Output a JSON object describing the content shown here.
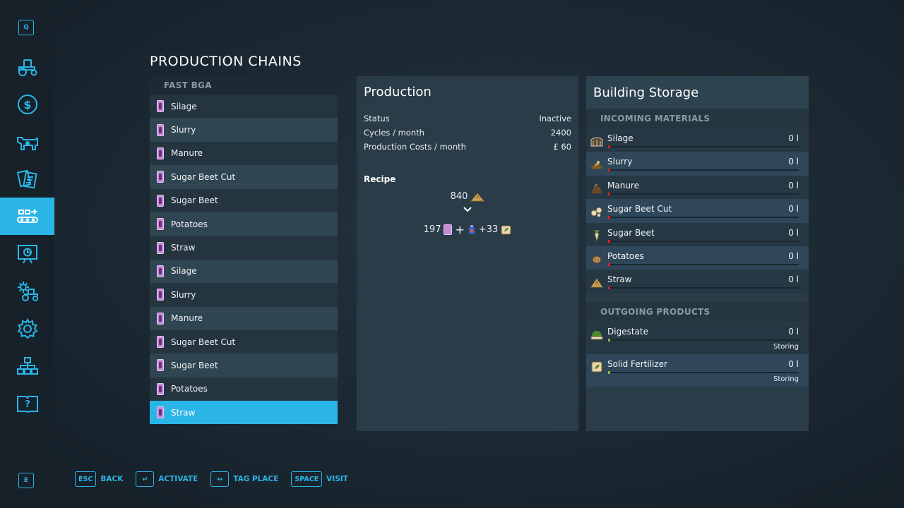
{
  "sidebar": {
    "top_key": "Q",
    "bottom_key": "E",
    "items": [
      {
        "icon": "tractor-icon",
        "active": false
      },
      {
        "icon": "money-icon",
        "active": false
      },
      {
        "icon": "cow-icon",
        "active": false
      },
      {
        "icon": "contracts-icon",
        "active": false
      },
      {
        "icon": "production-chain-icon",
        "active": true
      },
      {
        "icon": "statistics-icon",
        "active": false
      },
      {
        "icon": "garage-icon",
        "active": false
      },
      {
        "icon": "settings-gear-icon",
        "active": false
      },
      {
        "icon": "network-icon",
        "active": false
      },
      {
        "icon": "help-book-icon",
        "active": false
      }
    ]
  },
  "page_title": "PRODUCTION CHAINS",
  "chains": {
    "group_title": "FAST BGA",
    "items": [
      {
        "label": "Silage",
        "selected": false
      },
      {
        "label": "Slurry",
        "selected": false
      },
      {
        "label": "Manure",
        "selected": false
      },
      {
        "label": "Sugar Beet Cut",
        "selected": false
      },
      {
        "label": "Sugar Beet",
        "selected": false
      },
      {
        "label": "Potatoes",
        "selected": false
      },
      {
        "label": "Straw",
        "selected": false
      },
      {
        "label": "Silage",
        "selected": false
      },
      {
        "label": "Slurry",
        "selected": false
      },
      {
        "label": "Manure",
        "selected": false
      },
      {
        "label": "Sugar Beet Cut",
        "selected": false
      },
      {
        "label": "Sugar Beet",
        "selected": false
      },
      {
        "label": "Potatoes",
        "selected": false
      },
      {
        "label": "Straw",
        "selected": true
      }
    ]
  },
  "production": {
    "title": "Production",
    "status_label": "Status",
    "status_value": "Inactive",
    "cycles_label": "Cycles / month",
    "cycles_value": "2400",
    "costs_label": "Production Costs / month",
    "costs_value": "£ 60",
    "recipe_label": "Recipe",
    "recipe_output_amount": "840",
    "recipe_input_amount": "197",
    "recipe_plus": "+",
    "recipe_extra": "+33"
  },
  "storage": {
    "title": "Building Storage",
    "incoming_title": "INCOMING MATERIALS",
    "incoming": [
      {
        "name": "Silage",
        "value": "0 l",
        "icon": "silage-icon"
      },
      {
        "name": "Slurry",
        "value": "0 l",
        "icon": "slurry-icon"
      },
      {
        "name": "Manure",
        "value": "0 l",
        "icon": "manure-icon"
      },
      {
        "name": "Sugar Beet Cut",
        "value": "0 l",
        "icon": "sugar-beet-cut-icon"
      },
      {
        "name": "Sugar Beet",
        "value": "0 l",
        "icon": "sugar-beet-icon"
      },
      {
        "name": "Potatoes",
        "value": "0 l",
        "icon": "potatoes-icon"
      },
      {
        "name": "Straw",
        "value": "0 l",
        "icon": "straw-icon"
      }
    ],
    "outgoing_title": "OUTGOING PRODUCTS",
    "outgoing": [
      {
        "name": "Digestate",
        "value": "0 l",
        "status": "Storing",
        "icon": "digestate-icon"
      },
      {
        "name": "Solid Fertilizer",
        "value": "0 l",
        "status": "Storing",
        "icon": "solid-fertilizer-icon"
      }
    ]
  },
  "footer": {
    "hints": [
      {
        "key": "ESC",
        "label": "BACK"
      },
      {
        "key": "↵",
        "label": "ACTIVATE"
      },
      {
        "key": "↔",
        "label": "TAG PLACE"
      },
      {
        "key": "SPACE",
        "label": "VISIT"
      }
    ]
  },
  "colors": {
    "accent": "#2bb5e6",
    "panel": "#2a3c48",
    "bar_empty_incoming": "#d8202a",
    "bar_empty_outgoing": "#7bc043"
  }
}
